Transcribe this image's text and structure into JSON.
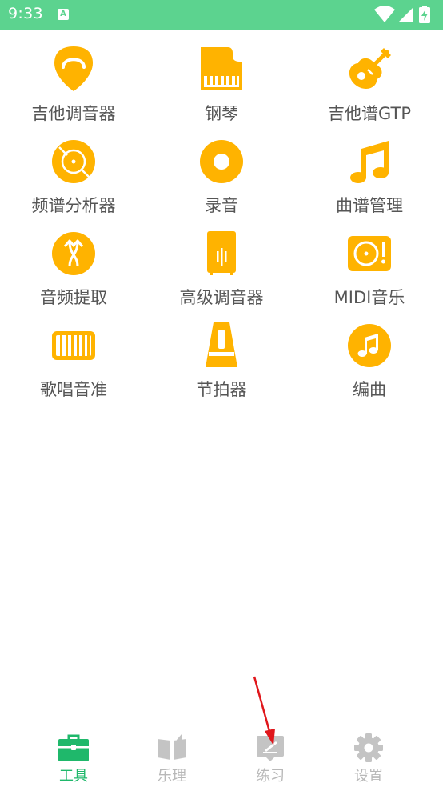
{
  "status_bar": {
    "time": "9:33",
    "app_icon_letter": "A",
    "icons": [
      "wifi-icon",
      "signal-icon",
      "battery-charging-icon"
    ]
  },
  "tools": [
    {
      "label": "吉他调音器",
      "icon": "guitar-pick-icon"
    },
    {
      "label": "钢琴",
      "icon": "piano-icon"
    },
    {
      "label": "吉他谱GTP",
      "icon": "guitar-icon"
    },
    {
      "label": "频谱分析器",
      "icon": "spectrum-disc-icon"
    },
    {
      "label": "录音",
      "icon": "record-icon"
    },
    {
      "label": "曲谱管理",
      "icon": "music-note-icon"
    },
    {
      "label": "音频提取",
      "icon": "audio-extract-icon"
    },
    {
      "label": "高级调音器",
      "icon": "advanced-tuner-icon"
    },
    {
      "label": "MIDI音乐",
      "icon": "midi-turntable-icon"
    },
    {
      "label": "歌唱音准",
      "icon": "keyboard-icon"
    },
    {
      "label": "节拍器",
      "icon": "metronome-icon"
    },
    {
      "label": "编曲",
      "icon": "compose-note-icon"
    }
  ],
  "bottom_nav": [
    {
      "label": "工具",
      "icon": "toolbox-icon",
      "active": true
    },
    {
      "label": "乐理",
      "icon": "book-icon",
      "active": false
    },
    {
      "label": "练习",
      "icon": "practice-icon",
      "active": false
    },
    {
      "label": "设置",
      "icon": "gear-icon",
      "active": false
    }
  ],
  "colors": {
    "status_bar": "#5cd38f",
    "icon_accent": "#ffb300",
    "active_tab": "#1fb86b",
    "inactive_tab": "#b8b8b8",
    "label_text": "#555555",
    "annotation_arrow": "#e0161b"
  }
}
